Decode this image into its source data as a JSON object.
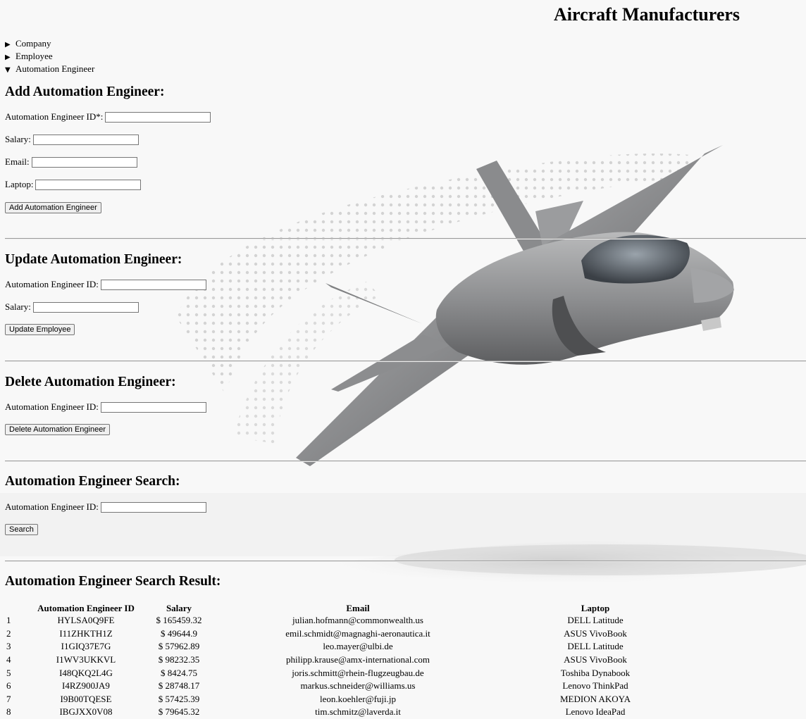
{
  "header": {
    "title": "Aircraft Manufacturers"
  },
  "nav": {
    "items": [
      {
        "label": "Company",
        "marker": "▶"
      },
      {
        "label": "Employee",
        "marker": "▶"
      },
      {
        "label": "Automation Engineer",
        "marker": "▼"
      }
    ]
  },
  "add_section": {
    "title": "Add Automation Engineer:",
    "id_label": "Automation Engineer ID*:",
    "salary_label": "Salary:",
    "email_label": "Email:",
    "laptop_label": "Laptop:",
    "button": "Add Automation Engineer"
  },
  "update_section": {
    "title": "Update Automation Engineer:",
    "id_label": "Automation Engineer ID:",
    "salary_label": "Salary:",
    "button": "Update Employee"
  },
  "delete_section": {
    "title": "Delete Automation Engineer:",
    "id_label": "Automation Engineer ID:",
    "button": "Delete Automation Engineer"
  },
  "search_section": {
    "title": "Automation Engineer Search:",
    "id_label": "Automation Engineer ID:",
    "button": "Search"
  },
  "results": {
    "title": "Automation Engineer Search Result:",
    "columns": [
      "",
      "Automation Engineer ID",
      "Salary",
      "Email",
      "Laptop"
    ],
    "rows": [
      [
        "1",
        "HYLSA0Q9FE",
        "$ 165459.32",
        "julian.hofmann@commonwealth.us",
        "DELL Latitude"
      ],
      [
        "2",
        "I11ZHKTH1Z",
        "$ 49644.9",
        "emil.schmidt@magnaghi-aeronautica.it",
        "ASUS VivoBook"
      ],
      [
        "3",
        "I1GIQ37E7G",
        "$ 57962.89",
        "leo.mayer@ulbi.de",
        "DELL Latitude"
      ],
      [
        "4",
        "I1WV3UKKVL",
        "$ 98232.35",
        "philipp.krause@amx-international.com",
        "ASUS VivoBook"
      ],
      [
        "5",
        "I48QKQ2L4G",
        "$ 8424.75",
        "joris.schmitt@rhein-flugzeugbau.de",
        "Toshiba Dynabook"
      ],
      [
        "6",
        "I4RZ900JA9",
        "$ 28748.17",
        "markus.schneider@williams.us",
        "Lenovo ThinkPad"
      ],
      [
        "7",
        "I9B00TQESE",
        "$ 57425.39",
        "leon.koehler@fuji.jp",
        "MEDION AKOYA"
      ],
      [
        "8",
        "IBGJXX0V08",
        "$ 79645.32",
        "tim.schmitz@laverda.it",
        "Lenovo IdeaPad"
      ]
    ]
  }
}
